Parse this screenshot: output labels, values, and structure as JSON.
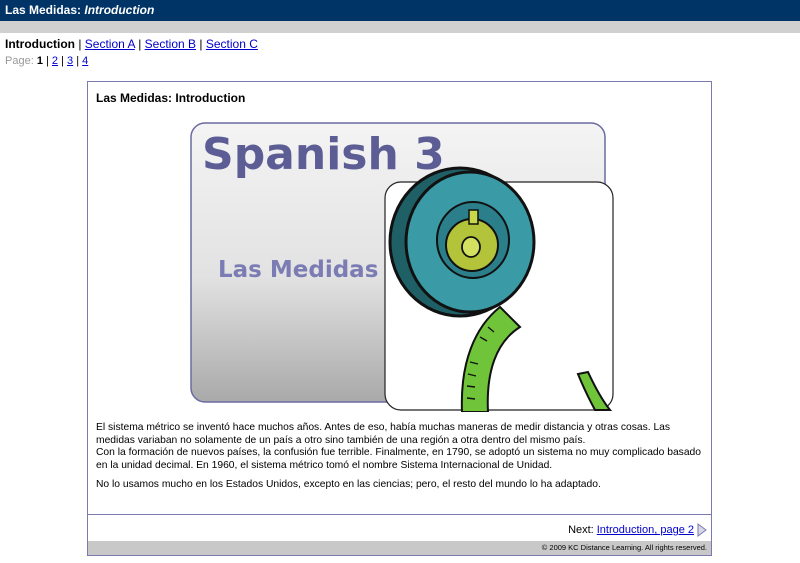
{
  "titlebar": {
    "prefix": "Las Medidas: ",
    "italic": "Introduction"
  },
  "sections": {
    "current": "Introduction",
    "links": [
      "Section A",
      "Section B",
      "Section C"
    ],
    "separator": "|"
  },
  "pages": {
    "label": "Page:",
    "current": "1",
    "links": [
      "2",
      "3",
      "4"
    ]
  },
  "content": {
    "title": "Las Medidas: Introduction",
    "graphic": {
      "heading": "Spanish 3",
      "subheading": "Las Medidas",
      "image_icon": "measuring-tape-icon"
    },
    "paragraphs": [
      "El sistema métrico se inventó hace muchos años. Antes de eso, había muchas maneras de medir distancia y otras cosas. Las medidas variaban no solamente de un país a otro sino también de una región a otra dentro del mismo país.",
      "Con la formación de nuevos países, la confusión fue terrible. Finalmente, en 1790, se adoptó un sistema no muy complicado basado en la unidad decimal. En 1960, el sistema métrico tomó el nombre Sistema Internacional de Unidad.",
      "No lo usamos mucho en los Estados Unidos, excepto en las ciencias; pero, el resto del mundo lo ha adaptado."
    ]
  },
  "navigation": {
    "next_label": "Next:",
    "next_link": "Introduction, page 2"
  },
  "footer": {
    "copyright": "© 2009 KC Distance Learning. All rights reserved."
  },
  "colors": {
    "titlebar": "#003366",
    "link": "#0000cc",
    "graphic_text": "#5d5d96",
    "tape_teal": "#2f8a96",
    "tape_green": "#6fc43a"
  }
}
